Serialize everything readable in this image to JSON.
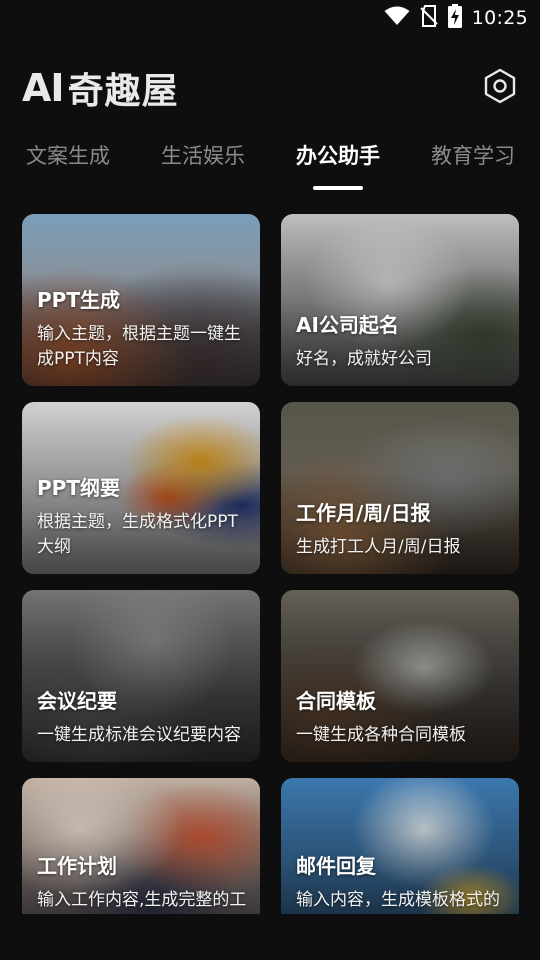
{
  "status_bar": {
    "time": "10:25",
    "icons": [
      "wifi-icon",
      "no-sim-icon",
      "battery-charging-icon"
    ]
  },
  "header": {
    "logo_ai": "AI",
    "logo_cn": "奇趣屋",
    "settings_icon": "hexagon-settings-icon"
  },
  "tabs": [
    {
      "label": "文案生成",
      "active": false
    },
    {
      "label": "生活娱乐",
      "active": false
    },
    {
      "label": "办公助手",
      "active": true
    },
    {
      "label": "教育学习",
      "active": false
    }
  ],
  "cards": [
    {
      "title": "PPT生成",
      "desc": "输入主题，根据主题一键生成PPT内容"
    },
    {
      "title": "AI公司起名",
      "desc": "好名，成就好公司"
    },
    {
      "title": "PPT纲要",
      "desc": "根据主题，生成格式化PPT大纲"
    },
    {
      "title": "工作月/周/日报",
      "desc": "生成打工人月/周/日报"
    },
    {
      "title": "会议纪要",
      "desc": "一键生成标准会议纪要内容"
    },
    {
      "title": "合同模板",
      "desc": "一键生成各种合同模板"
    },
    {
      "title": "工作计划",
      "desc": "输入工作内容,生成完整的工作计划"
    },
    {
      "title": "邮件回复",
      "desc": "输入内容，生成模板格式的邮件"
    }
  ],
  "colors": {
    "background": "#0e0e0e",
    "tab_inactive": "#8a8a8a",
    "tab_active": "#ffffff"
  }
}
